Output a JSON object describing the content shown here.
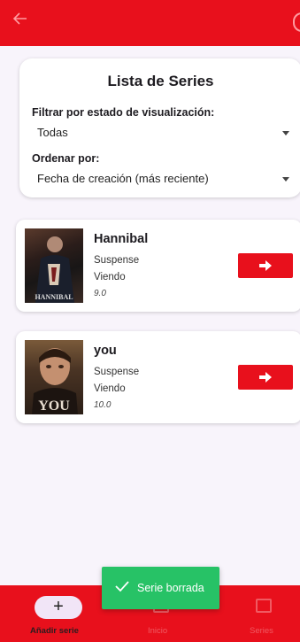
{
  "appbar": {
    "back_icon": "arrow-left-icon"
  },
  "filter": {
    "title": "Lista de Series",
    "status_label": "Filtrar por estado de visualización:",
    "status_value": "Todas",
    "sort_label": "Ordenar por:",
    "sort_value": "Fecha de creación (más reciente)"
  },
  "series": [
    {
      "title": "Hannibal",
      "genre": "Suspense",
      "status": "Viendo",
      "rating": "9.0",
      "poster_caption": "HANNIBAL"
    },
    {
      "title": "you",
      "genre": "Suspense",
      "status": "Viendo",
      "rating": "10.0",
      "poster_caption": "YOU"
    }
  ],
  "bottom_nav": {
    "add_label": "Añadir serie",
    "add_icon": "plus-icon",
    "second_label": "Inicio",
    "third_label": "Series"
  },
  "snackbar": {
    "message": "Serie borrada",
    "icon": "check-icon",
    "color": "#27c266"
  },
  "colors": {
    "accent": "#e8101c",
    "background": "#f8f4fb"
  }
}
